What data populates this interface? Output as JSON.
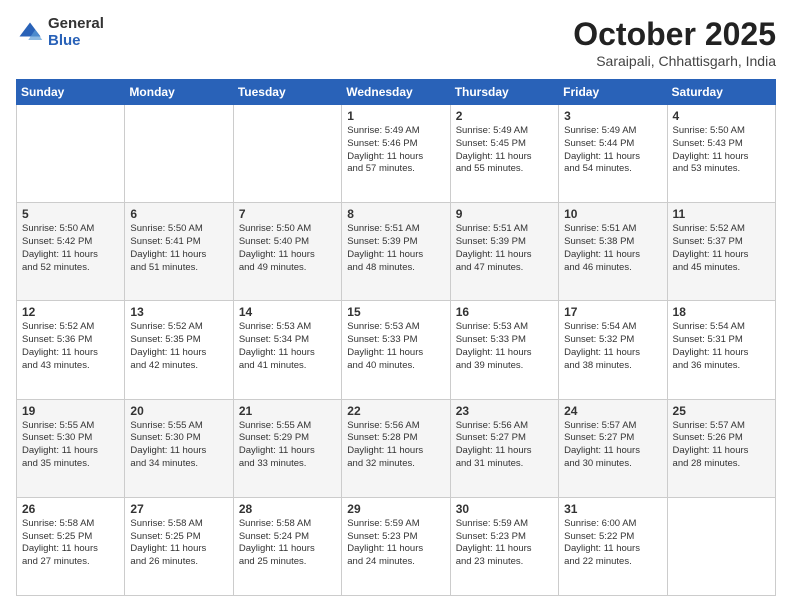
{
  "logo": {
    "general": "General",
    "blue": "Blue"
  },
  "title": "October 2025",
  "location": "Saraipali, Chhattisgarh, India",
  "days_header": [
    "Sunday",
    "Monday",
    "Tuesday",
    "Wednesday",
    "Thursday",
    "Friday",
    "Saturday"
  ],
  "weeks": [
    [
      {
        "day": "",
        "info": ""
      },
      {
        "day": "",
        "info": ""
      },
      {
        "day": "",
        "info": ""
      },
      {
        "day": "1",
        "info": "Sunrise: 5:49 AM\nSunset: 5:46 PM\nDaylight: 11 hours\nand 57 minutes."
      },
      {
        "day": "2",
        "info": "Sunrise: 5:49 AM\nSunset: 5:45 PM\nDaylight: 11 hours\nand 55 minutes."
      },
      {
        "day": "3",
        "info": "Sunrise: 5:49 AM\nSunset: 5:44 PM\nDaylight: 11 hours\nand 54 minutes."
      },
      {
        "day": "4",
        "info": "Sunrise: 5:50 AM\nSunset: 5:43 PM\nDaylight: 11 hours\nand 53 minutes."
      }
    ],
    [
      {
        "day": "5",
        "info": "Sunrise: 5:50 AM\nSunset: 5:42 PM\nDaylight: 11 hours\nand 52 minutes."
      },
      {
        "day": "6",
        "info": "Sunrise: 5:50 AM\nSunset: 5:41 PM\nDaylight: 11 hours\nand 51 minutes."
      },
      {
        "day": "7",
        "info": "Sunrise: 5:50 AM\nSunset: 5:40 PM\nDaylight: 11 hours\nand 49 minutes."
      },
      {
        "day": "8",
        "info": "Sunrise: 5:51 AM\nSunset: 5:39 PM\nDaylight: 11 hours\nand 48 minutes."
      },
      {
        "day": "9",
        "info": "Sunrise: 5:51 AM\nSunset: 5:39 PM\nDaylight: 11 hours\nand 47 minutes."
      },
      {
        "day": "10",
        "info": "Sunrise: 5:51 AM\nSunset: 5:38 PM\nDaylight: 11 hours\nand 46 minutes."
      },
      {
        "day": "11",
        "info": "Sunrise: 5:52 AM\nSunset: 5:37 PM\nDaylight: 11 hours\nand 45 minutes."
      }
    ],
    [
      {
        "day": "12",
        "info": "Sunrise: 5:52 AM\nSunset: 5:36 PM\nDaylight: 11 hours\nand 43 minutes."
      },
      {
        "day": "13",
        "info": "Sunrise: 5:52 AM\nSunset: 5:35 PM\nDaylight: 11 hours\nand 42 minutes."
      },
      {
        "day": "14",
        "info": "Sunrise: 5:53 AM\nSunset: 5:34 PM\nDaylight: 11 hours\nand 41 minutes."
      },
      {
        "day": "15",
        "info": "Sunrise: 5:53 AM\nSunset: 5:33 PM\nDaylight: 11 hours\nand 40 minutes."
      },
      {
        "day": "16",
        "info": "Sunrise: 5:53 AM\nSunset: 5:33 PM\nDaylight: 11 hours\nand 39 minutes."
      },
      {
        "day": "17",
        "info": "Sunrise: 5:54 AM\nSunset: 5:32 PM\nDaylight: 11 hours\nand 38 minutes."
      },
      {
        "day": "18",
        "info": "Sunrise: 5:54 AM\nSunset: 5:31 PM\nDaylight: 11 hours\nand 36 minutes."
      }
    ],
    [
      {
        "day": "19",
        "info": "Sunrise: 5:55 AM\nSunset: 5:30 PM\nDaylight: 11 hours\nand 35 minutes."
      },
      {
        "day": "20",
        "info": "Sunrise: 5:55 AM\nSunset: 5:30 PM\nDaylight: 11 hours\nand 34 minutes."
      },
      {
        "day": "21",
        "info": "Sunrise: 5:55 AM\nSunset: 5:29 PM\nDaylight: 11 hours\nand 33 minutes."
      },
      {
        "day": "22",
        "info": "Sunrise: 5:56 AM\nSunset: 5:28 PM\nDaylight: 11 hours\nand 32 minutes."
      },
      {
        "day": "23",
        "info": "Sunrise: 5:56 AM\nSunset: 5:27 PM\nDaylight: 11 hours\nand 31 minutes."
      },
      {
        "day": "24",
        "info": "Sunrise: 5:57 AM\nSunset: 5:27 PM\nDaylight: 11 hours\nand 30 minutes."
      },
      {
        "day": "25",
        "info": "Sunrise: 5:57 AM\nSunset: 5:26 PM\nDaylight: 11 hours\nand 28 minutes."
      }
    ],
    [
      {
        "day": "26",
        "info": "Sunrise: 5:58 AM\nSunset: 5:25 PM\nDaylight: 11 hours\nand 27 minutes."
      },
      {
        "day": "27",
        "info": "Sunrise: 5:58 AM\nSunset: 5:25 PM\nDaylight: 11 hours\nand 26 minutes."
      },
      {
        "day": "28",
        "info": "Sunrise: 5:58 AM\nSunset: 5:24 PM\nDaylight: 11 hours\nand 25 minutes."
      },
      {
        "day": "29",
        "info": "Sunrise: 5:59 AM\nSunset: 5:23 PM\nDaylight: 11 hours\nand 24 minutes."
      },
      {
        "day": "30",
        "info": "Sunrise: 5:59 AM\nSunset: 5:23 PM\nDaylight: 11 hours\nand 23 minutes."
      },
      {
        "day": "31",
        "info": "Sunrise: 6:00 AM\nSunset: 5:22 PM\nDaylight: 11 hours\nand 22 minutes."
      },
      {
        "day": "",
        "info": ""
      }
    ]
  ]
}
